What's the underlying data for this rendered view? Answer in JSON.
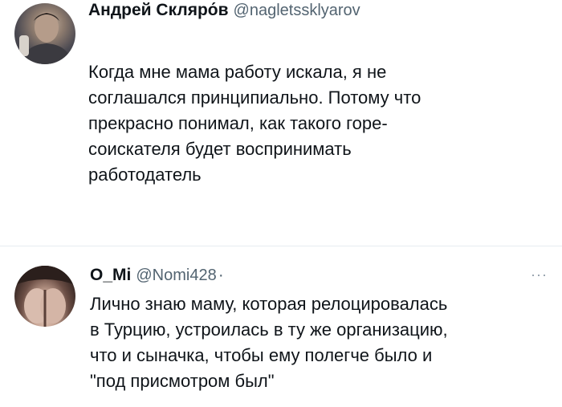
{
  "tweets": [
    {
      "display_name": "Андрей Скляро́в",
      "handle": "@nagletssklyarov",
      "text": "Когда мне мама работу искала, я не\nсоглашался принципиально. Потому что\nпрекрасно понимал, как такого горе-\nсоискателя будет воспринимать\nработодатель",
      "avatar_icon": "user-photo-avatar"
    },
    {
      "display_name": "O_Mi",
      "handle": "@Nomi428",
      "separator": "·",
      "more_label": "···",
      "text": "Лично знаю маму, которая релоцировалась\nв Турцию, устроилась в ту же организацию,\nчто и сыначка, чтобы ему полегче было и\n\"под присмотром был\"",
      "avatar_icon": "user-photo-avatar"
    }
  ],
  "colors": {
    "text_primary": "#0f1419",
    "text_secondary": "#536471",
    "divider": "#e6ecf0",
    "background": "#ffffff"
  }
}
